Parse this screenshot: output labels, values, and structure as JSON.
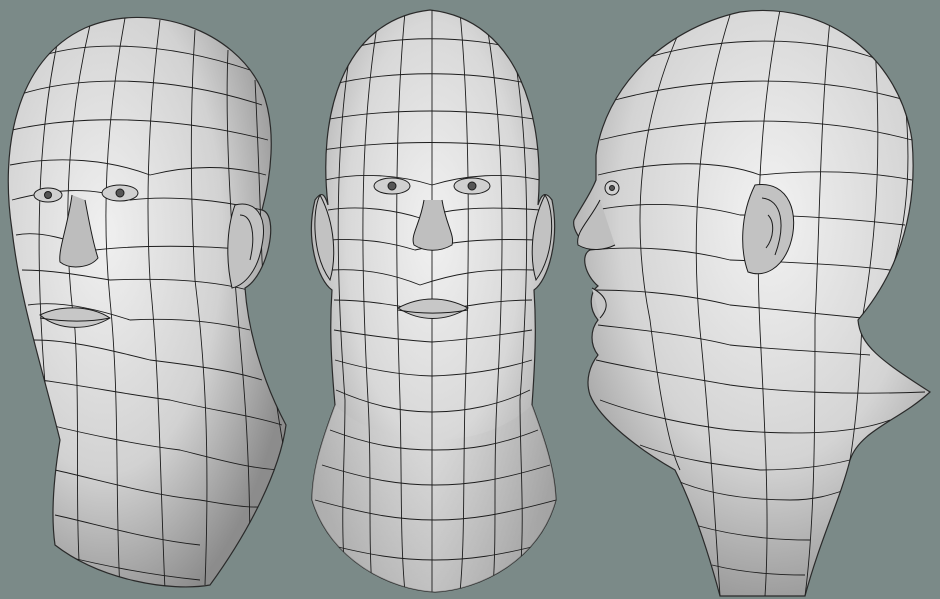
{
  "colors": {
    "background": "#7b8a88",
    "skin_light": "#e6e6e6",
    "skin_mid": "#c9c9c9",
    "skin_shadow": "#8f8f8f",
    "wire": "#1c1c1c"
  },
  "views": [
    {
      "id": "three-quarter",
      "icon": "head-three-quarter-view"
    },
    {
      "id": "front",
      "icon": "head-front-view"
    },
    {
      "id": "profile",
      "icon": "head-profile-view"
    }
  ]
}
